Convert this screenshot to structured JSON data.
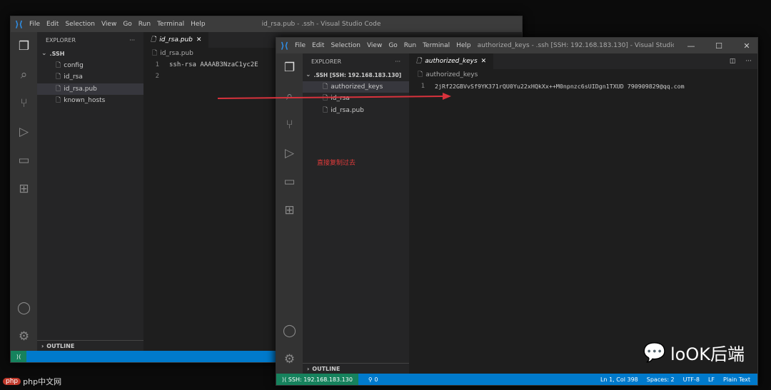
{
  "left_window": {
    "menu": [
      "File",
      "Edit",
      "Selection",
      "View",
      "Go",
      "Run",
      "Terminal",
      "Help"
    ],
    "title": "id_rsa.pub - .ssh - Visual Studio Code",
    "explorer_label": "EXPLORER",
    "folder": ".SSH",
    "files": [
      "config",
      "id_rsa",
      "id_rsa.pub",
      "known_hosts"
    ],
    "tab": "id_rsa.pub",
    "breadcrumb": "id_rsa.pub",
    "lines": [
      {
        "n": "1",
        "text": "ssh-rsa AAAAB3NzaC1yc2E"
      },
      {
        "n": "2",
        "text": ""
      }
    ],
    "outline": "OUTLINE"
  },
  "right_window": {
    "menu": [
      "File",
      "Edit",
      "Selection",
      "View",
      "Go",
      "Run",
      "Terminal",
      "Help"
    ],
    "title": "authorized_keys - .ssh [SSH: 192.168.183.130] - Visual Studio ...",
    "explorer_label": "EXPLORER",
    "folder": ".SSH [SSH: 192.168.183.130]",
    "files": [
      "authorized_keys",
      "id_rsa",
      "id_rsa.pub"
    ],
    "tab": "authorized_keys",
    "breadcrumb": "authorized_keys",
    "lines": [
      {
        "n": "1",
        "text": "2jRf22GBVvSf9YK371rQU0Yu22xHQkXx++M0npnzc6sUIDgn1TXUD 790909829@qq.com"
      }
    ],
    "annotation": "直接复制过去",
    "outline": "OUTLINE",
    "status": {
      "remote": "SSH: 192.168.183.130",
      "ports": "0",
      "position": "Ln 1, Col 398",
      "spaces": "Spaces: 2",
      "encoding": "UTF-8",
      "eol": "LF",
      "language": "Plain Text"
    }
  },
  "watermark": "loOK后端",
  "site_mark": "php中文网",
  "colors": {
    "accent": "#007acc",
    "remote": "#16825d",
    "arrow": "#d8323c"
  }
}
